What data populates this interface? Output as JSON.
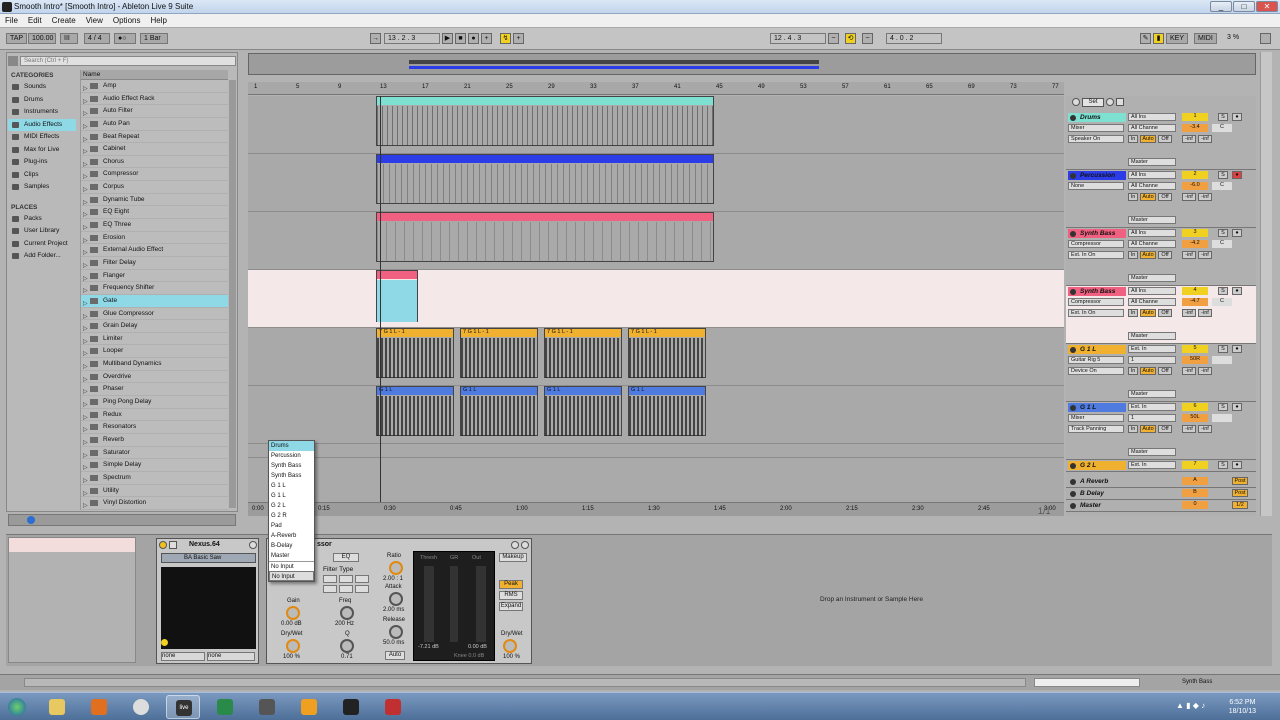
{
  "window": {
    "title": "Smooth Intro*  [Smooth Intro] - Ableton Live 9 Suite"
  },
  "menu": [
    "File",
    "Edit",
    "Create",
    "View",
    "Options",
    "Help"
  ],
  "transport": {
    "tap": "TAP",
    "tempo": "100.00",
    "sig": "4 / 4",
    "quant": "1 Bar",
    "position": "13 .  2 .  3",
    "loop_start": "12 .  4 .  3",
    "loop_len": "4 .  0 .  2",
    "key": "KEY",
    "midi": "MIDI",
    "cpu": "3 %"
  },
  "browser": {
    "search_placeholder": "Search (Ctrl + F)",
    "categories_label": "CATEGORIES",
    "categories": [
      "Sounds",
      "Drums",
      "Instruments",
      "Audio Effects",
      "MIDI Effects",
      "Max for Live",
      "Plug-ins",
      "Clips",
      "Samples"
    ],
    "places_label": "PLACES",
    "places": [
      "Packs",
      "User Library",
      "Current Project",
      "Add Folder..."
    ],
    "name_header": "Name",
    "items": [
      "Amp",
      "Audio Effect Rack",
      "Auto Filter",
      "Auto Pan",
      "Beat Repeat",
      "Cabinet",
      "Chorus",
      "Compressor",
      "Corpus",
      "Dynamic Tube",
      "EQ Eight",
      "EQ Three",
      "Erosion",
      "External Audio Effect",
      "Filter Delay",
      "Flanger",
      "Frequency Shifter",
      "Gate",
      "Glue Compressor",
      "Grain Delay",
      "Limiter",
      "Looper",
      "Multiband Dynamics",
      "Overdrive",
      "Phaser",
      "Ping Pong Delay",
      "Redux",
      "Resonators",
      "Reverb",
      "Saturator",
      "Simple Delay",
      "Spectrum",
      "Utility",
      "Vinyl Distortion"
    ]
  },
  "ruler": {
    "bars": [
      "1",
      "5",
      "9",
      "13",
      "17",
      "21",
      "25",
      "29",
      "33",
      "37",
      "41",
      "45",
      "49",
      "53",
      "57",
      "61",
      "65",
      "69",
      "73",
      "77"
    ],
    "times": [
      "0:00",
      "0:15",
      "0:30",
      "0:45",
      "1:00",
      "1:15",
      "1:30",
      "1:45",
      "2:00",
      "2:15",
      "2:30",
      "2:45",
      "3:00"
    ]
  },
  "clips": {
    "drum3": "7 G 1 L - 1",
    "drum4": "7 G 1 L - 1",
    "gl": "G 1 L"
  },
  "tracks": [
    {
      "name": "Drums",
      "in": "All Ins",
      "ch": "All Channe",
      "dev": "Mixer",
      "mon": "Speaker On",
      "num": "1",
      "vol": "-3.4",
      "pan": "C",
      "color": "#7de0d0"
    },
    {
      "name": "Percussion",
      "in": "All Ins",
      "ch": "All Channe",
      "dev": "None",
      "mon": "",
      "num": "2",
      "vol": "-6.0",
      "pan": "C",
      "color": "#2c3de8"
    },
    {
      "name": "Synth Bass",
      "in": "All Ins",
      "ch": "All Channe",
      "dev": "Compressor",
      "mon": "Ext. In On",
      "num": "3",
      "vol": "-4.2",
      "pan": "C",
      "color": "#f06080"
    },
    {
      "name": "Synth Bass",
      "in": "All Ins",
      "ch": "All Channe",
      "dev": "Compressor",
      "mon": "Ext. In On",
      "num": "4",
      "vol": "-4.7",
      "pan": "C",
      "color": "#f06080"
    },
    {
      "name": "G 1 L",
      "in": "Ext. In",
      "ch": "1",
      "dev": "Guitar Rig 5",
      "mon": "Device On",
      "num": "5",
      "vol": "50R",
      "pan": "",
      "color": "#f0b030"
    },
    {
      "name": "G 1 L",
      "in": "Ext. In",
      "ch": "1",
      "dev": "Mixer",
      "mon": "Track Panning",
      "num": "6",
      "vol": "50L",
      "pan": "",
      "color": "#4f7ae0"
    },
    {
      "name": "G 2 L",
      "in": "Ext. In",
      "ch": "",
      "dev": "",
      "mon": "",
      "num": "7",
      "vol": "",
      "pan": "",
      "color": "#f0b030"
    }
  ],
  "returns": [
    {
      "name": "A Reverb",
      "num": "A",
      "post": "Post"
    },
    {
      "name": "B Delay",
      "num": "B",
      "post": "Post"
    },
    {
      "name": "Master",
      "num": "0",
      "post": "1/2"
    }
  ],
  "set_label": "Set",
  "mixer_misc": {
    "in": "In",
    "auto": "Auto",
    "off": "Off",
    "inf": "-inf",
    "master": "Master",
    "none": "None"
  },
  "page": "1/1",
  "dropdown": {
    "items": [
      "Drums",
      "Percussion",
      "Synth Bass",
      "Synth Bass",
      "G 1 L",
      "G 1 L",
      "G 2 L",
      "G 2 R",
      "Pad",
      "A-Reverb",
      "B-Delay",
      "Master"
    ],
    "no_input": "No Input",
    "no_input2": "No Input"
  },
  "nexus": {
    "title": "Nexus.64",
    "preset": "BA Basic Saw",
    "none1": "none",
    "none2": "none"
  },
  "comp": {
    "title": "ssor",
    "eq": "EQ",
    "filter_type": "Filter Type",
    "ratio_label": "Ratio",
    "ratio": "2.00 : 1",
    "attack_label": "Attack",
    "attack": "2.00 ms",
    "release_label": "Release",
    "release": "50.0 ms",
    "auto": "Auto",
    "gain_label": "Gain",
    "gain": "0.00 dB",
    "drywet_label": "Dry/Wet",
    "drywet": "100 %",
    "freq_label": "Freq",
    "freq": "200 Hz",
    "q_label": "Q",
    "q": "0.71",
    "thresh": "Thresh",
    "gr": "GR",
    "out": "Out",
    "thresh_val": "-7.21 dB",
    "out_val": "0.00 dB",
    "knee": "Knee 0.0 dB",
    "makeup": "Makeup",
    "peak": "Peak",
    "rms": "RMS",
    "expand": "Expand",
    "drywet2": "Dry/Wet",
    "drywet2_val": "100 %"
  },
  "hint": "Drop an Instrument or Sample Here",
  "status": {
    "track": "Synth Bass"
  },
  "clock": {
    "time": "6:52 PM",
    "date": "18/10/13"
  },
  "colors": {
    "cyan": "#8fd9e6",
    "orange": "#f0b030",
    "blue": "#4f7ae0",
    "pink": "#f06080"
  }
}
